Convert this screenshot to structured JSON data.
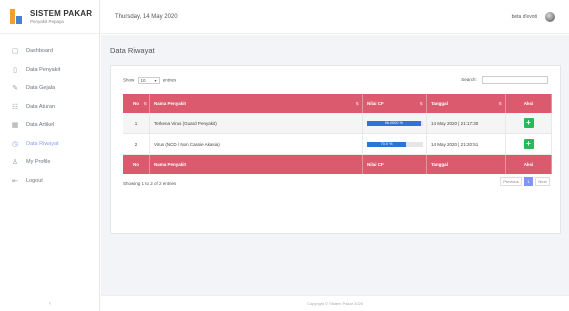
{
  "brand": {
    "title": "SISTEM PAKAR",
    "subtitle": "Penyakit Pepaya"
  },
  "sidebar": {
    "items": [
      {
        "label": "Dashboard",
        "icon": "monitor-icon",
        "glyph": "▢"
      },
      {
        "label": "Data Penyakit",
        "icon": "file-icon",
        "glyph": "▯"
      },
      {
        "label": "Data Gejala",
        "icon": "edit-icon",
        "glyph": "✎"
      },
      {
        "label": "Data Aturan",
        "icon": "grid-icon",
        "glyph": "☷"
      },
      {
        "label": "Data Artikel",
        "icon": "table-icon",
        "glyph": "▦"
      },
      {
        "label": "Data Riwayat",
        "icon": "history-icon",
        "glyph": "◷",
        "active": true
      },
      {
        "label": "My Profile",
        "icon": "user-icon",
        "glyph": "♙"
      },
      {
        "label": "Logout",
        "icon": "logout-icon",
        "glyph": "⇤"
      }
    ],
    "collapse_glyph": "‹"
  },
  "topbar": {
    "date": "Thursday, 14 May 2020",
    "user_name": "beta d'evoti"
  },
  "page": {
    "title": "Data Riwayat"
  },
  "table_controls": {
    "show_label": "Show",
    "page_length": "10",
    "entries_label": "entries",
    "search_label": "Search:",
    "search_value": ""
  },
  "table": {
    "columns": [
      "No",
      "Nama Penyakit",
      "Nilai CF",
      "Tanggal",
      "Aksi"
    ],
    "rows": [
      {
        "no": "1",
        "penyakit": "Terkena Virus (Guard Penyakit)",
        "cf_label": "96.0000 %",
        "cf_fraction": 0.96,
        "tanggal": "14 May 2020 | 21:17:30",
        "action_glyph": "+"
      },
      {
        "no": "2",
        "penyakit": "Virus (NCD / Non Cassie Akasia)",
        "cf_label": "70.0 %",
        "cf_fraction": 0.7,
        "tanggal": "14 May 2020 | 21:20:51",
        "action_glyph": "+"
      }
    ]
  },
  "table_info": "Showing 1 to 2 of 2 entries",
  "pagination": {
    "previous": "Previous",
    "current": "1",
    "next": "Next"
  },
  "footer": {
    "text": "Copyright © Sistem Pakar 2020"
  },
  "colors": {
    "header_red": "#dc5a6e",
    "cf_blue": "#2e73d6",
    "action_green": "#28b95a",
    "active_nav": "#8aa0f0"
  }
}
